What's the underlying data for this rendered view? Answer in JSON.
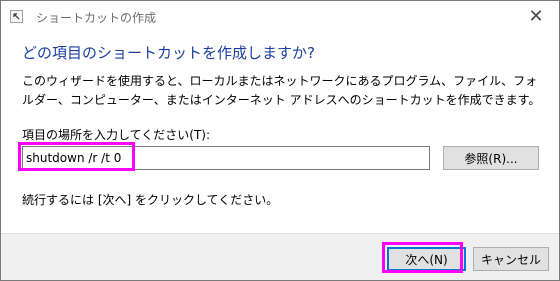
{
  "window": {
    "title": "ショートカットの作成",
    "close_glyph": "✕"
  },
  "main": {
    "heading": "どの項目のショートカットを作成しますか?",
    "description": "このウィザードを使用すると、ローカルまたはネットワークにあるプログラム、ファイル、フォルダー、コンピューター、またはインターネット アドレスへのショートカットを作成できます。",
    "field_label": "項目の場所を入力してください(T):",
    "path_value": "shutdown /r /t 0",
    "browse_label": "参照(R)...",
    "footer_text": "続行するには [次へ] をクリックしてください。"
  },
  "buttons": {
    "next_label": "次へ(N)",
    "cancel_label": "キャンセル"
  },
  "colors": {
    "heading": "#1b3fa0",
    "highlight": "#ff00ff",
    "accent": "#0078d7"
  },
  "icons": {
    "back": "back-arrow-icon",
    "close": "close-icon"
  }
}
